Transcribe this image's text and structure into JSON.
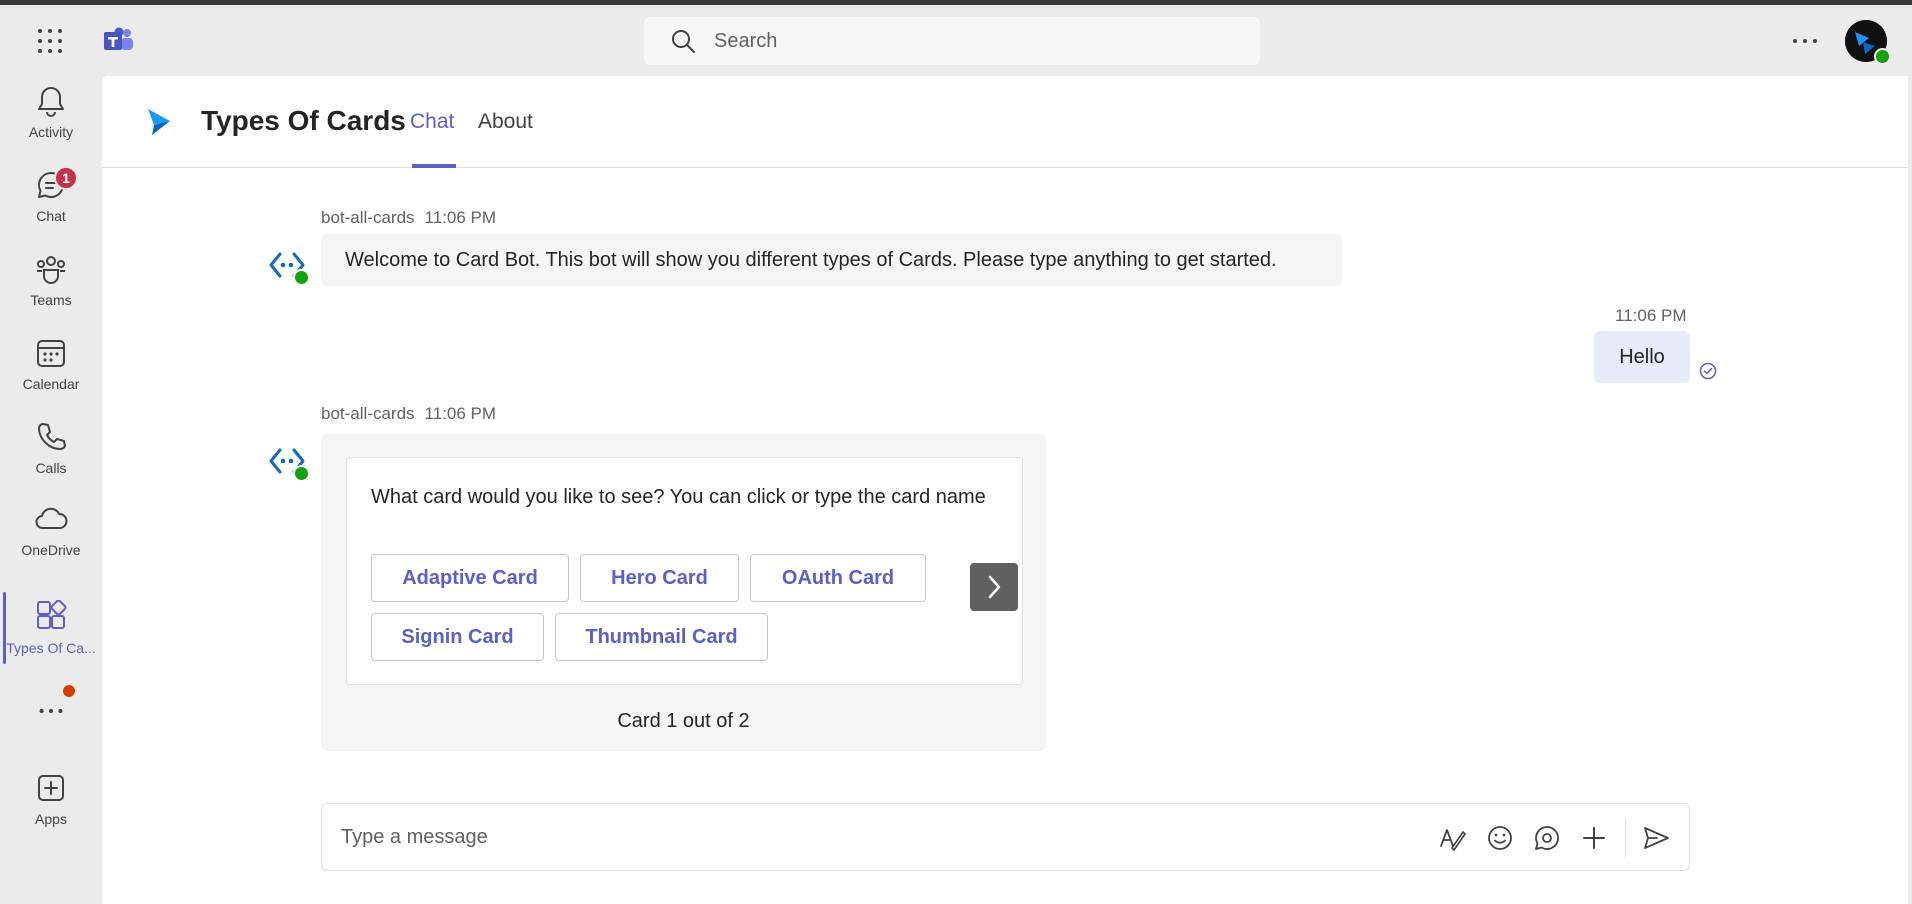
{
  "topbar": {
    "search_placeholder": "Search",
    "icons": {
      "apps": "waffle-icon",
      "teams": "teams-logo-icon",
      "search": "search-icon",
      "more": "more-options-icon"
    }
  },
  "rail": {
    "items": [
      {
        "label": "Activity",
        "icon": "bell-icon"
      },
      {
        "label": "Chat",
        "icon": "chat-icon",
        "badge": "1"
      },
      {
        "label": "Teams",
        "icon": "teams-icon"
      },
      {
        "label": "Calendar",
        "icon": "calendar-icon"
      },
      {
        "label": "Calls",
        "icon": "phone-icon"
      },
      {
        "label": "OneDrive",
        "icon": "cloud-icon"
      },
      {
        "label": "Types Of Ca...",
        "icon": "app-icon",
        "active": true
      },
      {
        "label": "",
        "icon": "more-apps-icon"
      },
      {
        "label": "Apps",
        "icon": "add-app-icon"
      }
    ]
  },
  "app": {
    "title": "Types Of Cards",
    "tabs": [
      {
        "label": "Chat",
        "active": true
      },
      {
        "label": "About"
      }
    ]
  },
  "messages": [
    {
      "sender": "bot-all-cards",
      "time": "11:06 PM",
      "text": "Welcome to Card Bot. This bot will show you different types of Cards. Please type anything to get started."
    },
    {
      "sender": "",
      "time": "11:06 PM",
      "text": "Hello",
      "outgoing": true
    },
    {
      "sender": "bot-all-cards",
      "time": "11:06 PM",
      "card": {
        "text": "What card would you like to see? You can click or type the card name",
        "buttons": [
          "Adaptive Card",
          "Hero Card",
          "OAuth Card",
          "Signin Card",
          "Thumbnail Card"
        ],
        "counter": "Card 1 out of 2"
      }
    }
  ],
  "composer": {
    "placeholder": "Type a message"
  },
  "colors": {
    "accent": "#5b5fc7",
    "presence": "#13a10e",
    "badge": "#c4314b",
    "notification_dot": "#d83b01"
  }
}
